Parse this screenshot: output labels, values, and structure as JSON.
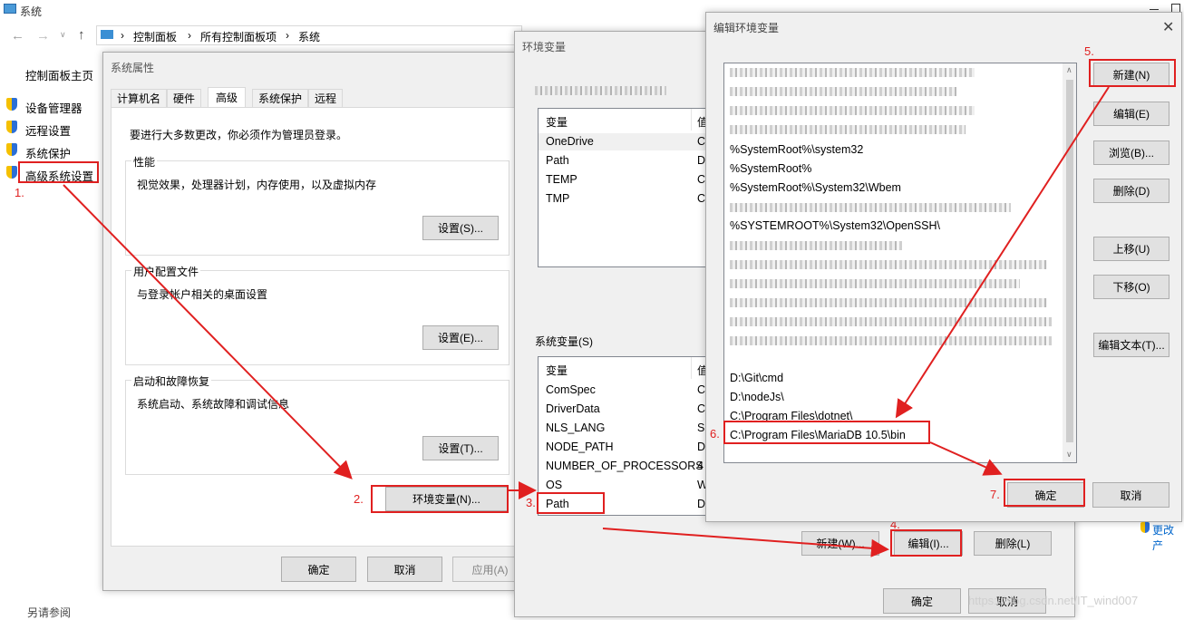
{
  "system_window": {
    "title": "系统",
    "breadcrumb": [
      "控制面板",
      "所有控制面板项",
      "系统"
    ],
    "sidebar_home": "控制面板主页",
    "sidebar_items": [
      "设备管理器",
      "远程设置",
      "系统保护",
      "高级系统设置"
    ],
    "see_also": "另请参阅",
    "right_link": "更改产"
  },
  "sys_props": {
    "title": "系统属性",
    "tabs": [
      "计算机名",
      "硬件",
      "高级",
      "系统保护",
      "远程"
    ],
    "note": "要进行大多数更改，你必须作为管理员登录。",
    "perf_label": "性能",
    "perf_desc": "视觉效果，处理器计划，内存使用，以及虚拟内存",
    "perf_btn": "设置(S)...",
    "profile_label": "用户配置文件",
    "profile_desc": "与登录帐户相关的桌面设置",
    "profile_btn": "设置(E)...",
    "startup_label": "启动和故障恢复",
    "startup_desc": "系统启动、系统故障和调试信息",
    "startup_btn": "设置(T)...",
    "env_btn": "环境变量(N)...",
    "ok": "确定",
    "cancel": "取消",
    "apply": "应用(A)"
  },
  "env_vars": {
    "title": "环境变量",
    "user_header": [
      "变量",
      "值"
    ],
    "user_vars": [
      "OneDrive",
      "Path",
      "TEMP",
      "TMP"
    ],
    "user_vals": [
      "C:",
      "D",
      "C:",
      "C:"
    ],
    "sys_label": "系统变量(S)",
    "sys_header": [
      "变量",
      "值"
    ],
    "sys_vars": [
      "ComSpec",
      "DriverData",
      "NLS_LANG",
      "NODE_PATH",
      "NUMBER_OF_PROCESSORS",
      "OS",
      "Path"
    ],
    "sys_vals": [
      "C:",
      "C:",
      "SI",
      "D",
      "4",
      "W",
      "D"
    ],
    "new_btn": "新建(W)...",
    "edit_btn": "编辑(I)...",
    "delete_btn": "删除(L)",
    "ok": "确定",
    "cancel": "取消"
  },
  "edit_env": {
    "title": "编辑环境变量",
    "entries": [
      "",
      "",
      "",
      "",
      "%SystemRoot%\\system32",
      "%SystemRoot%",
      "%SystemRoot%\\System32\\Wbem",
      "",
      "%SYSTEMROOT%\\System32\\OpenSSH\\",
      "",
      "",
      "",
      "",
      "",
      "",
      "D:\\Git\\cmd",
      "D:\\nodeJs\\",
      "C:\\Program Files\\dotnet\\",
      "C:\\Program Files\\MariaDB 10.5\\bin"
    ],
    "buttons": [
      "新建(N)",
      "编辑(E)",
      "浏览(B)...",
      "删除(D)",
      "上移(U)",
      "下移(O)",
      "编辑文本(T)..."
    ],
    "ok": "确定",
    "cancel": "取消"
  },
  "steps": [
    "1.",
    "2.",
    "3.",
    "4.",
    "5.",
    "6.",
    "7."
  ],
  "watermark": "https://blog.csdn.net/IT_wind007",
  "colors": {
    "annotation": "#e02020",
    "selection": "#cce8ff"
  }
}
